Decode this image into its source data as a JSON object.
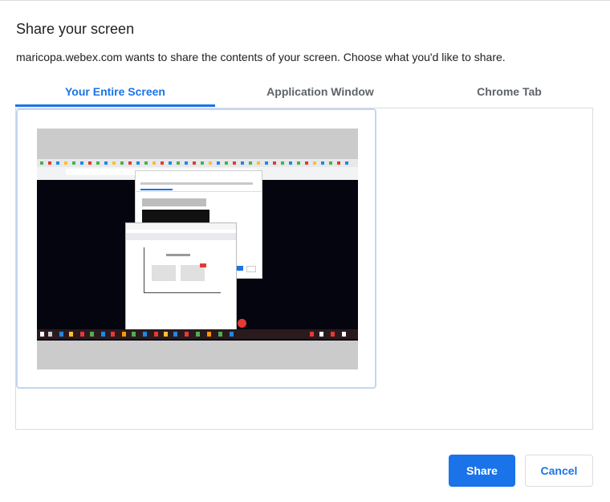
{
  "dialog": {
    "title": "Share your screen",
    "subtitle": "maricopa.webex.com wants to share the contents of your screen. Choose what you'd like to share."
  },
  "tabs": [
    {
      "label": "Your Entire Screen",
      "active": true
    },
    {
      "label": "Application Window",
      "active": false
    },
    {
      "label": "Chrome Tab",
      "active": false
    }
  ],
  "buttons": {
    "share_label": "Share",
    "cancel_label": "Cancel"
  },
  "colors": {
    "accent": "#1a73e8",
    "border": "#dadce0",
    "selected_border": "#c2d7f5"
  }
}
